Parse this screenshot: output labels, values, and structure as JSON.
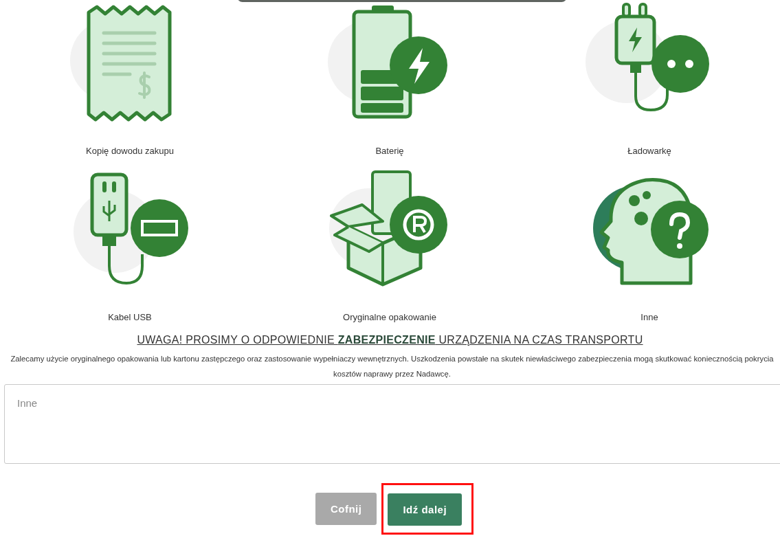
{
  "items": [
    {
      "kind": "receipt",
      "label": "Kopię dowodu zakupu"
    },
    {
      "kind": "battery",
      "label": "Baterię"
    },
    {
      "kind": "charger",
      "label": "Ładowarkę"
    },
    {
      "kind": "usb",
      "label": "Kabel USB"
    },
    {
      "kind": "box",
      "label": "Oryginalne opakowanie"
    },
    {
      "kind": "head",
      "label": "Inne"
    }
  ],
  "notice": {
    "heading": "UWAGA! PROSIMY O ODPOWIEDNIE **ZABEZPIECZENIE** URZĄDZENIA NA CZAS TRANSPORTU",
    "text": "Zalecamy użycie oryginalnego opakowania lub kartonu zastępczego oraz zastosowanie wypełniaczy wewnętrznych. Uszkodzenia powstałe na skutek niewłaściwego zabezpieczenia mogą skutkować koniecznością pokrycia kosztów naprawy przez Nadawcę."
  },
  "comment_field": {
    "placeholder": "Inne"
  },
  "buttons": [
    {
      "label": "Cofnij",
      "disabled": true,
      "highlighted": false
    },
    {
      "label": "Idź dalej",
      "disabled": false,
      "highlighted": true
    }
  ]
}
